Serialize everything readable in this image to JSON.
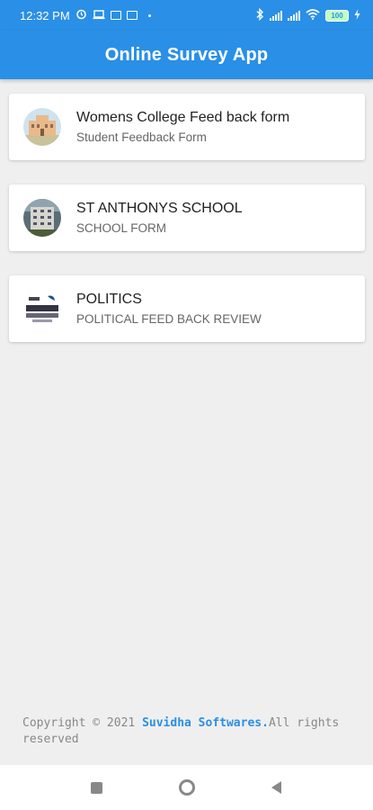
{
  "status_bar": {
    "time": "12:32 PM",
    "battery": "100",
    "icons": [
      "alarm-icon",
      "laptop-icon",
      "save-icon",
      "save-icon",
      "bluetooth-icon",
      "signal-icon",
      "signal-icon",
      "wifi-icon",
      "battery-icon",
      "charging-icon"
    ]
  },
  "app_bar": {
    "title": "Online Survey App",
    "color": "#2a8fe6"
  },
  "surveys": [
    {
      "title": "Womens College Feed back form",
      "subtitle": "Student Feedback Form",
      "icon": "college-building-thumbnail"
    },
    {
      "title": "ST ANTHONYS SCHOOL",
      "subtitle": "SCHOOL FORM",
      "icon": "school-building-thumbnail"
    },
    {
      "title": "POLITICS",
      "subtitle": "POLITICAL FEED BACK REVIEW",
      "icon": "property-logo-thumbnail"
    }
  ],
  "footer": {
    "prefix": "Copyright © 2021 ",
    "brand": "Suvidha Softwares.",
    "suffix": "All rights reserved"
  },
  "nav_bar": {
    "icons": [
      "recent-apps-icon",
      "home-icon",
      "back-icon"
    ]
  }
}
